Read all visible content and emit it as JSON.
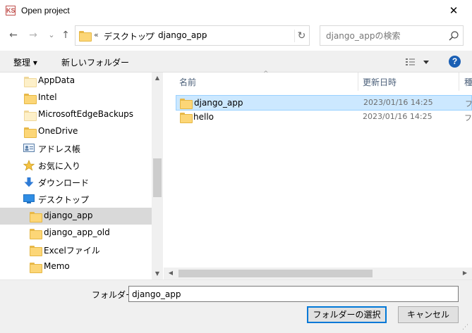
{
  "window": {
    "title": "Open project",
    "app_icon_text": "KS",
    "close_glyph": "✕"
  },
  "address": {
    "back_glyph": "←",
    "forward_glyph": "→",
    "recent_glyph": "⌄",
    "up_glyph": "↑",
    "overflow": "«",
    "crumbs": [
      "デスクトップ",
      "django_app"
    ],
    "sep_glyph": "›",
    "dropdown_glyph": "▼",
    "refresh_glyph": "↻"
  },
  "search": {
    "placeholder": "django_appの検索"
  },
  "toolbar": {
    "organize_label": "整理 ▾",
    "new_folder_label": "新しいフォルダー",
    "help_label": "?"
  },
  "nav": {
    "items": [
      {
        "label": "AppData",
        "icon": "folder-icon"
      },
      {
        "label": "Intel",
        "icon": "folder-icon"
      },
      {
        "label": "MicrosoftEdgeBackups",
        "icon": "folder-icon"
      },
      {
        "label": "OneDrive",
        "icon": "folder-icon"
      },
      {
        "label": "アドレス帳",
        "icon": "contacts-icon"
      },
      {
        "label": "お気に入り",
        "icon": "star-icon"
      },
      {
        "label": "ダウンロード",
        "icon": "download-icon"
      },
      {
        "label": "デスクトップ",
        "icon": "desktop-icon"
      },
      {
        "label": "django_app",
        "icon": "folder-icon"
      },
      {
        "label": "django_app_old",
        "icon": "folder-icon"
      },
      {
        "label": "Excelファイル",
        "icon": "folder-icon"
      },
      {
        "label": "Memo",
        "icon": "folder-icon"
      }
    ],
    "selected": "django_app"
  },
  "columns": {
    "name": "名前",
    "modified": "更新日時",
    "type": "種"
  },
  "files": [
    {
      "name": "django_app",
      "date": "2023/01/16 14:25",
      "type": "ファ",
      "selected": true
    },
    {
      "name": "hello",
      "date": "2023/01/16 14:25",
      "type": "ファ",
      "selected": false
    }
  ],
  "bottom": {
    "folder_label": "フォルダー:",
    "folder_value": "django_app",
    "select_button": "フォルダーの選択",
    "cancel_button": "キャンセル"
  },
  "colors": {
    "selection": "#cce8ff",
    "accent": "#0078d7",
    "help": "#1a5fb4"
  }
}
